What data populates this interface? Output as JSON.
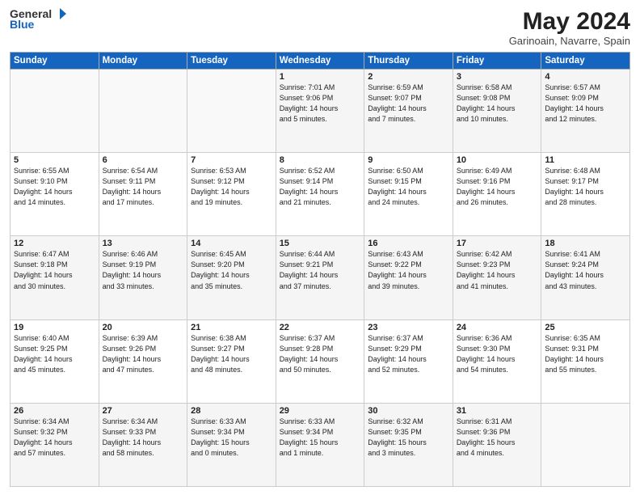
{
  "header": {
    "logo_general": "General",
    "logo_blue": "Blue",
    "month_title": "May 2024",
    "location": "Garinoain, Navarre, Spain"
  },
  "weekdays": [
    "Sunday",
    "Monday",
    "Tuesday",
    "Wednesday",
    "Thursday",
    "Friday",
    "Saturday"
  ],
  "weeks": [
    [
      {
        "day": "",
        "info": ""
      },
      {
        "day": "",
        "info": ""
      },
      {
        "day": "",
        "info": ""
      },
      {
        "day": "1",
        "info": "Sunrise: 7:01 AM\nSunset: 9:06 PM\nDaylight: 14 hours\nand 5 minutes."
      },
      {
        "day": "2",
        "info": "Sunrise: 6:59 AM\nSunset: 9:07 PM\nDaylight: 14 hours\nand 7 minutes."
      },
      {
        "day": "3",
        "info": "Sunrise: 6:58 AM\nSunset: 9:08 PM\nDaylight: 14 hours\nand 10 minutes."
      },
      {
        "day": "4",
        "info": "Sunrise: 6:57 AM\nSunset: 9:09 PM\nDaylight: 14 hours\nand 12 minutes."
      }
    ],
    [
      {
        "day": "5",
        "info": "Sunrise: 6:55 AM\nSunset: 9:10 PM\nDaylight: 14 hours\nand 14 minutes."
      },
      {
        "day": "6",
        "info": "Sunrise: 6:54 AM\nSunset: 9:11 PM\nDaylight: 14 hours\nand 17 minutes."
      },
      {
        "day": "7",
        "info": "Sunrise: 6:53 AM\nSunset: 9:12 PM\nDaylight: 14 hours\nand 19 minutes."
      },
      {
        "day": "8",
        "info": "Sunrise: 6:52 AM\nSunset: 9:14 PM\nDaylight: 14 hours\nand 21 minutes."
      },
      {
        "day": "9",
        "info": "Sunrise: 6:50 AM\nSunset: 9:15 PM\nDaylight: 14 hours\nand 24 minutes."
      },
      {
        "day": "10",
        "info": "Sunrise: 6:49 AM\nSunset: 9:16 PM\nDaylight: 14 hours\nand 26 minutes."
      },
      {
        "day": "11",
        "info": "Sunrise: 6:48 AM\nSunset: 9:17 PM\nDaylight: 14 hours\nand 28 minutes."
      }
    ],
    [
      {
        "day": "12",
        "info": "Sunrise: 6:47 AM\nSunset: 9:18 PM\nDaylight: 14 hours\nand 30 minutes."
      },
      {
        "day": "13",
        "info": "Sunrise: 6:46 AM\nSunset: 9:19 PM\nDaylight: 14 hours\nand 33 minutes."
      },
      {
        "day": "14",
        "info": "Sunrise: 6:45 AM\nSunset: 9:20 PM\nDaylight: 14 hours\nand 35 minutes."
      },
      {
        "day": "15",
        "info": "Sunrise: 6:44 AM\nSunset: 9:21 PM\nDaylight: 14 hours\nand 37 minutes."
      },
      {
        "day": "16",
        "info": "Sunrise: 6:43 AM\nSunset: 9:22 PM\nDaylight: 14 hours\nand 39 minutes."
      },
      {
        "day": "17",
        "info": "Sunrise: 6:42 AM\nSunset: 9:23 PM\nDaylight: 14 hours\nand 41 minutes."
      },
      {
        "day": "18",
        "info": "Sunrise: 6:41 AM\nSunset: 9:24 PM\nDaylight: 14 hours\nand 43 minutes."
      }
    ],
    [
      {
        "day": "19",
        "info": "Sunrise: 6:40 AM\nSunset: 9:25 PM\nDaylight: 14 hours\nand 45 minutes."
      },
      {
        "day": "20",
        "info": "Sunrise: 6:39 AM\nSunset: 9:26 PM\nDaylight: 14 hours\nand 47 minutes."
      },
      {
        "day": "21",
        "info": "Sunrise: 6:38 AM\nSunset: 9:27 PM\nDaylight: 14 hours\nand 48 minutes."
      },
      {
        "day": "22",
        "info": "Sunrise: 6:37 AM\nSunset: 9:28 PM\nDaylight: 14 hours\nand 50 minutes."
      },
      {
        "day": "23",
        "info": "Sunrise: 6:37 AM\nSunset: 9:29 PM\nDaylight: 14 hours\nand 52 minutes."
      },
      {
        "day": "24",
        "info": "Sunrise: 6:36 AM\nSunset: 9:30 PM\nDaylight: 14 hours\nand 54 minutes."
      },
      {
        "day": "25",
        "info": "Sunrise: 6:35 AM\nSunset: 9:31 PM\nDaylight: 14 hours\nand 55 minutes."
      }
    ],
    [
      {
        "day": "26",
        "info": "Sunrise: 6:34 AM\nSunset: 9:32 PM\nDaylight: 14 hours\nand 57 minutes."
      },
      {
        "day": "27",
        "info": "Sunrise: 6:34 AM\nSunset: 9:33 PM\nDaylight: 14 hours\nand 58 minutes."
      },
      {
        "day": "28",
        "info": "Sunrise: 6:33 AM\nSunset: 9:34 PM\nDaylight: 15 hours\nand 0 minutes."
      },
      {
        "day": "29",
        "info": "Sunrise: 6:33 AM\nSunset: 9:34 PM\nDaylight: 15 hours\nand 1 minute."
      },
      {
        "day": "30",
        "info": "Sunrise: 6:32 AM\nSunset: 9:35 PM\nDaylight: 15 hours\nand 3 minutes."
      },
      {
        "day": "31",
        "info": "Sunrise: 6:31 AM\nSunset: 9:36 PM\nDaylight: 15 hours\nand 4 minutes."
      },
      {
        "day": "",
        "info": ""
      }
    ]
  ]
}
